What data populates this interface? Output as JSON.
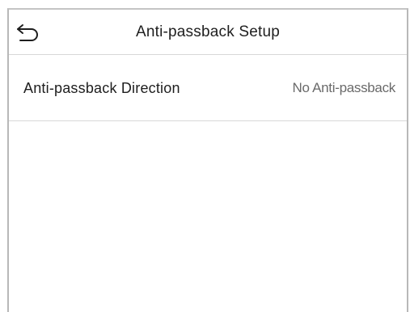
{
  "header": {
    "title": "Anti-passback Setup",
    "back_icon": "return-arrow-icon"
  },
  "settings": [
    {
      "label": "Anti-passback Direction",
      "value": "No Anti-passback"
    }
  ],
  "colors": {
    "text_primary": "#1e1e1e",
    "text_secondary": "#6a6a6a",
    "divider": "#d8d8d8",
    "background": "#ffffff"
  }
}
